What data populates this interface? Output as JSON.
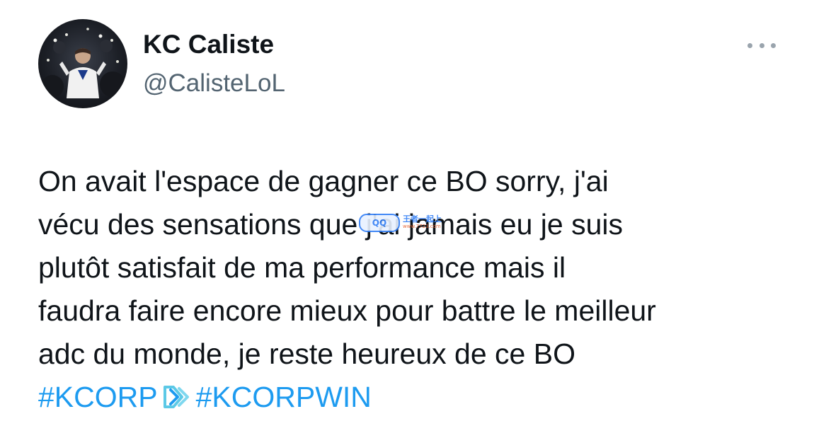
{
  "tweet": {
    "author": {
      "display_name": "KC Caliste",
      "handle": "@CalisteLoL"
    },
    "more_icon": "ellipsis-icon",
    "text_lines": [
      "On avait l'espace de gagner ce BO sorry, j'ai",
      "vécu des sensations que j'ai jamais eu je suis",
      "plutôt satisfait de ma performance mais il",
      "faudra faire encore mieux pour battre le meilleur",
      "adc du monde, je reste heureux de ce BO"
    ],
    "hashtags": [
      "#KCORP",
      "#KCORPWIN"
    ],
    "emoji_icon": "kcorp-logo-icon"
  },
  "watermark": {
    "logo_text": "QQ",
    "main_text": "王者一起上",
    "sub_text": "www.7723.com"
  },
  "colors": {
    "text": "#0f1419",
    "secondary": "#536471",
    "hashtag": "#1d9bf0"
  }
}
